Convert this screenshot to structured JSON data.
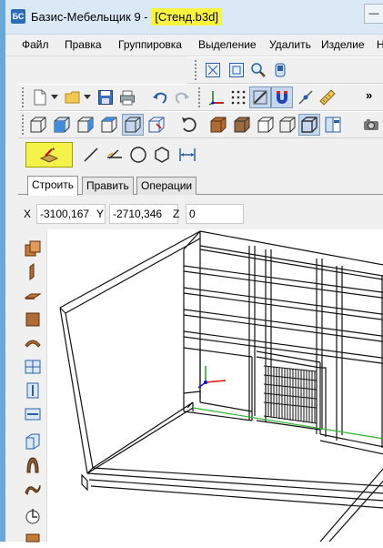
{
  "window": {
    "title_prefix": "Базис-Мебельщик 9 - ",
    "title_file": "[Стенд.b3d]",
    "highlight_color": "#f8f33c"
  },
  "menu": {
    "items": [
      "Файл",
      "Правка",
      "Группировка",
      "Выделение",
      "Удалить",
      "Изделие",
      "Н"
    ]
  },
  "draw_tools": {
    "tabs": [
      "Строить",
      "Править",
      "Операции"
    ],
    "active_tab": "Строить",
    "tools": [
      "panel-draw-icon",
      "line-icon",
      "angle-line-icon",
      "circle-icon",
      "hexagon-icon",
      "dimension-icon"
    ]
  },
  "coords": {
    "x_label": "X",
    "x_value": "-3100,167",
    "y_label": "Y",
    "y_value": "-2710,346",
    "z_label": "Z",
    "z_value": "0"
  },
  "toolbars": {
    "more_glyph": "»"
  }
}
